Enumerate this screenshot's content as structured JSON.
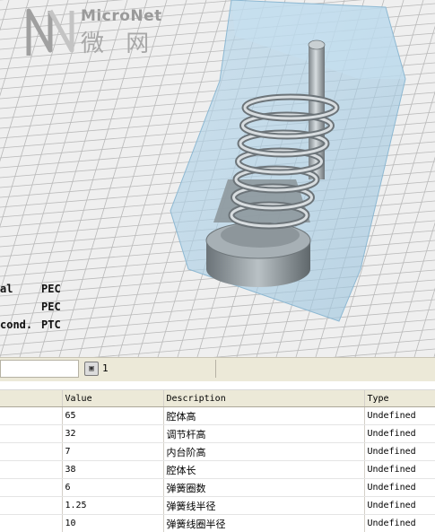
{
  "logo": {
    "brand": "MicroNet",
    "brand_cn": "微 网"
  },
  "boundary_legend": [
    {
      "name": "al",
      "value": "PEC"
    },
    {
      "name": "",
      "value": "PEC"
    },
    {
      "name": "cond.",
      "value": "PTC"
    }
  ],
  "toolbar": {
    "field_value": "",
    "tab_label": "1",
    "tab_icon": "window-icon"
  },
  "table": {
    "columns": [
      "",
      "Value",
      "Description",
      "Type"
    ],
    "rows": [
      {
        "name": "",
        "value": "65",
        "description": "腔体高",
        "type": "Undefined"
      },
      {
        "name": "",
        "value": "32",
        "description": "调节杆高",
        "type": "Undefined"
      },
      {
        "name": "",
        "value": "7",
        "description": "内台阶高",
        "type": "Undefined"
      },
      {
        "name": "",
        "value": "38",
        "description": "腔体长",
        "type": "Undefined"
      },
      {
        "name": "",
        "value": "6",
        "description": "弹簧圈数",
        "type": "Undefined"
      },
      {
        "name": "",
        "value": "1.25",
        "description": "弹簧线半径",
        "type": "Undefined"
      },
      {
        "name": "",
        "value": "10",
        "description": "弹簧线圈半径",
        "type": "Undefined"
      }
    ]
  },
  "colors": {
    "viewport_bg": "#efefef",
    "grid": "#b9b9b9",
    "cavity_fill": "#a9cde4",
    "metal": "#9aa3a8"
  }
}
